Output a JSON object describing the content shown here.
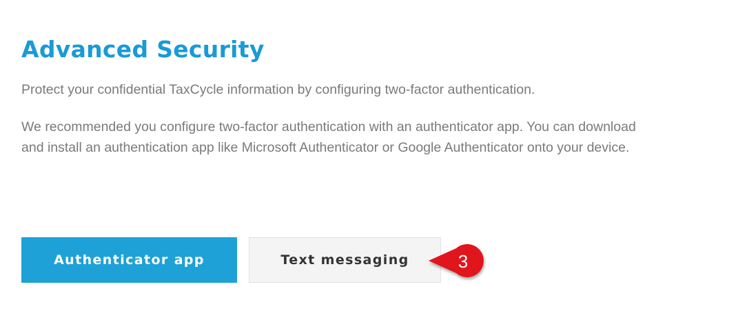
{
  "page": {
    "title": "Advanced Security",
    "intro": "Protect your confidential TaxCycle information by configuring two-factor authentication.",
    "recommendation_line1": "We recommended you configure two-factor authentication with an authenticator app. You can download",
    "recommendation_line2": "and install an authentication app like Microsoft Authenticator or Google Authenticator onto your device."
  },
  "buttons": {
    "authenticator_app": "Authenticator app",
    "text_messaging": "Text messaging"
  },
  "callout": {
    "number": "3",
    "color": "#e0121b"
  },
  "colors": {
    "title": "#1a9ad6",
    "primary_button": "#1ea1d7",
    "body_text": "#7a7a7a"
  }
}
